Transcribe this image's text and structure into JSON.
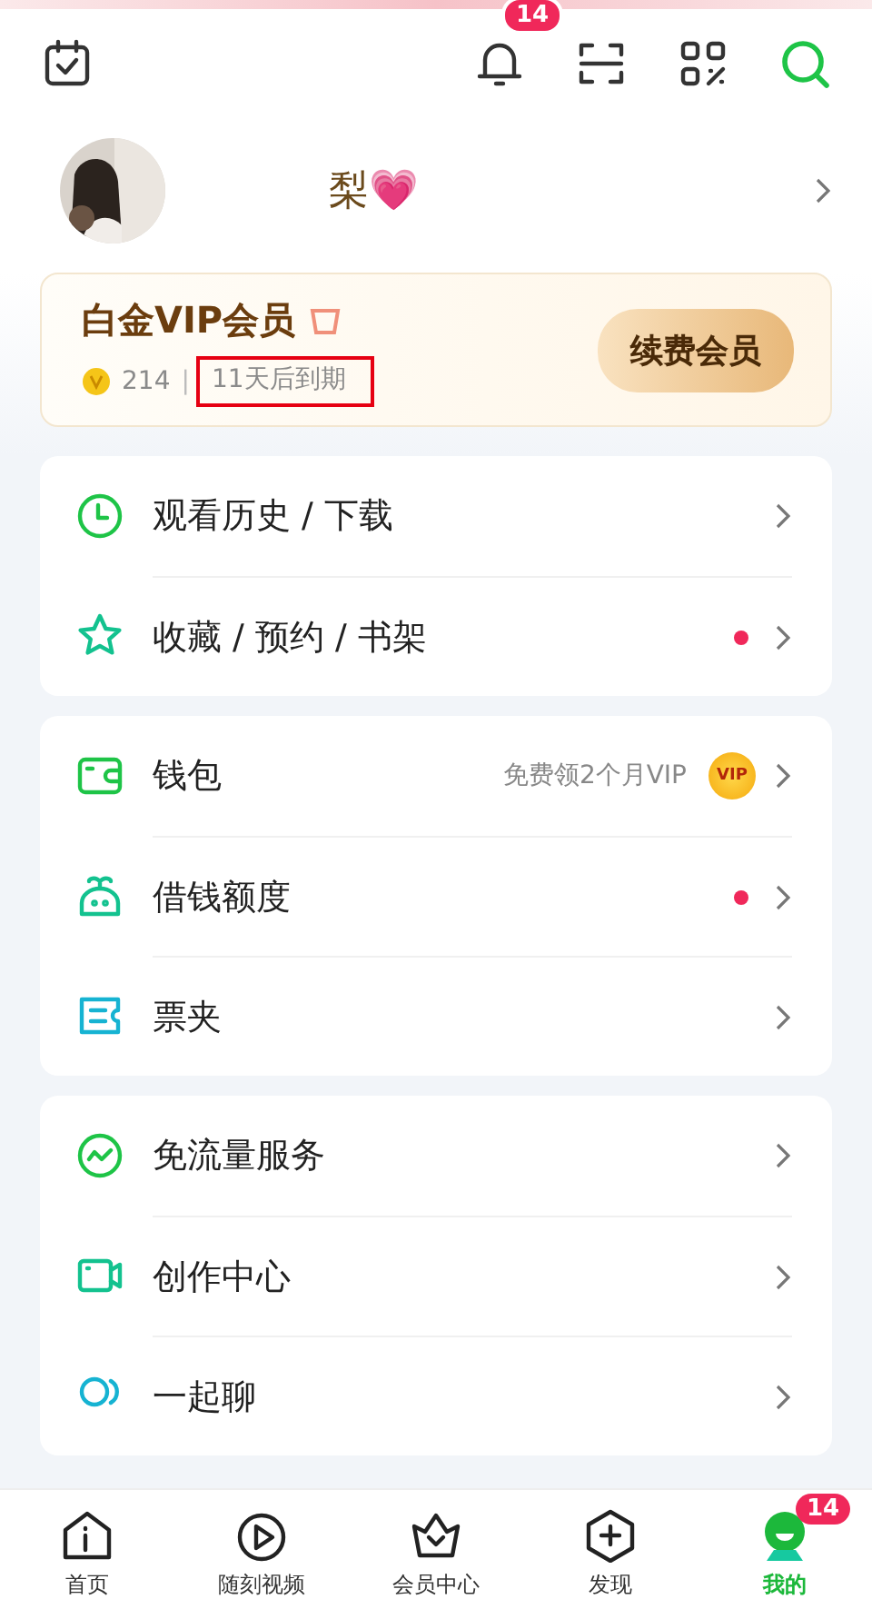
{
  "header": {
    "notification_badge": "14"
  },
  "profile": {
    "name": "梨💗"
  },
  "vip": {
    "title": "白金VIP会员",
    "points": "214",
    "separator": "|",
    "expiry": "11天后到期",
    "expiry_highlighted": true,
    "button": "续费会员"
  },
  "groups": [
    {
      "items": [
        {
          "kind": "clock",
          "label": "观看历史 / 下载",
          "red_dot": false
        },
        {
          "kind": "star",
          "label": "收藏 / 预约 / 书架",
          "red_dot": true
        }
      ]
    },
    {
      "items": [
        {
          "kind": "wallet",
          "label": "钱包",
          "hint": "免费领2个月VIP",
          "vip_coin": "VIP",
          "red_dot": false
        },
        {
          "kind": "sprout",
          "label": "借钱额度",
          "red_dot": true
        },
        {
          "kind": "ticket",
          "label": "票夹",
          "red_dot": false
        }
      ]
    },
    {
      "items": [
        {
          "kind": "trend",
          "label": "免流量服务",
          "red_dot": false
        },
        {
          "kind": "camera",
          "label": "创作中心",
          "red_dot": false
        },
        {
          "kind": "chat",
          "label": "一起聊",
          "red_dot": false
        }
      ]
    }
  ],
  "tabs": [
    {
      "kind": "home",
      "label": "首页",
      "selected": false
    },
    {
      "kind": "video",
      "label": "随刻视频",
      "selected": false
    },
    {
      "kind": "crown",
      "label": "会员中心",
      "selected": false
    },
    {
      "kind": "discover",
      "label": "发现",
      "selected": false
    },
    {
      "kind": "me",
      "label": "我的",
      "selected": true,
      "badge": "14"
    }
  ]
}
